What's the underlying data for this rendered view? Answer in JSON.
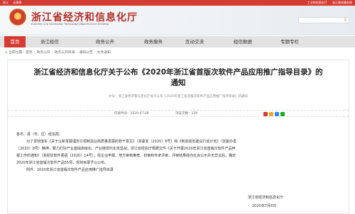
{
  "topbar": {
    "left_1": "浙江",
    "left_2": "无障碍",
    "right_1": "工业和信息化厅",
    "right_2": "浙江政务服务网"
  },
  "header": {
    "title": "浙江省经济和信息化厅",
    "subtitle": "Economy and Information Technology Department of Zhejiang",
    "search_placeholder": ""
  },
  "nav": {
    "items": [
      "首页",
      "浙江经信",
      "政务公开",
      "政务服务",
      "互动交流",
      "经信数据",
      "专题专栏"
    ]
  },
  "breadcrumb": {
    "prefix": "当前位置：",
    "items": [
      "首页",
      "政务公开",
      "政务公开目录",
      "通知公告",
      "文件通知"
    ]
  },
  "doc": {
    "title_line1": "浙江省经济和信息化厅关于公布《2020年浙江省首版次软件产品应用推广指导目录》的",
    "title_line2": "通知",
    "docnum": "文号：浙江省经济和信息化厅关于公布《2020年浙江省首版次软件产品应用推广指导目录》的通知",
    "publish_date": "印发时间：2020-07-08",
    "views": "浏览次数：239",
    "salutation": "各市、县（市、区）经信局：",
    "para1_line1": "为了贯彻落实《关于以新发展理念引领制造业高质量发展的若干意见》（浙委发〔2020〕6号）和《制造强省建设行动计划》（浙委办发",
    "para1_line2": "〔2020〕8号）精神，聚力打好产业基础高级化、产业链现代化攻坚战，浙江省经信厅根据文件《关于开展2020年浙江省首版次软件产品申",
    "para1_line3": "报工作的通知》（浙经信软件便函〔2020〕14号），经企业申报、地方审核推荐、初审和专家评审，评审结果经向社会公示并无异议后，确定",
    "para1_line4": "2020年浙江省首版次软件产品55项，现将目录予以公布。",
    "attachment": "附件：2020年浙江省首版次软件产品应用推广指导目录",
    "sign_org": "浙江省经济和信息化厅",
    "sign_date": "2020年7月8日"
  },
  "colors": {
    "brand_red": "#d43c33",
    "nav_bg": "#e2e2e2"
  }
}
